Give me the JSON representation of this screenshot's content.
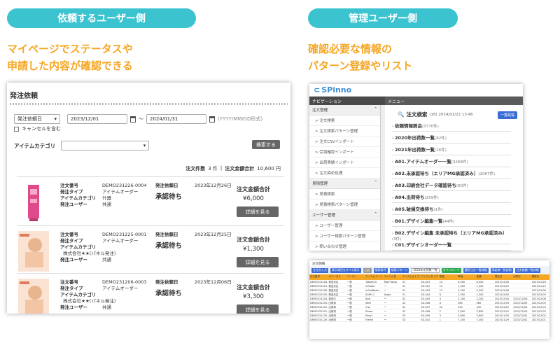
{
  "left_section": {
    "pill": "依頼するユーザー側",
    "headline": [
      "マイページでステータスや",
      "申請した内容が確認できる"
    ],
    "panel": {
      "title": "発注依頼",
      "filter": {
        "date_type": "発注依頼日",
        "date_from": "2023/12/01",
        "tilde": "〜",
        "date_to": "2024/01/31",
        "date_hint": "(YYYY/MM/DD形式)",
        "cancel_label": "キャンセルを含む",
        "category_label": "アイテムカテゴリ",
        "search_button": "検索する"
      },
      "summary": {
        "count_label": "注文件数",
        "count": "3 件",
        "sep": "|",
        "total_label": "注文金額合計",
        "total": "10,600 円"
      },
      "labels": {
        "order_no": "注文番号",
        "order_type": "発注タイプ",
        "item_category": "アイテムカテゴリ",
        "orderer": "発注ユーザー",
        "request_date": "発注依頼日",
        "total_label": "注文金額合計",
        "detail_button": "詳細を見る"
      },
      "orders": [
        {
          "order_no": "DEMO231226-0004",
          "order_type": "アイテムオーダー",
          "category": "什器",
          "company": "",
          "orderer": "共通",
          "date": "2023年12月26日",
          "status": "承認待ち",
          "price": "¥6,000"
        },
        {
          "order_no": "DEMO231225-0001",
          "order_type": "アイテムオーダー",
          "category": "",
          "company": "株式会社★★(パネル発注)",
          "orderer": "共通",
          "date": "2023年12月25日",
          "status": "承認待ち",
          "price": "¥1,300"
        },
        {
          "order_no": "DEMO231206-0003",
          "order_type": "アイテムオーダー",
          "category": "",
          "company": "株式会社★★(パネル発注)",
          "orderer": "共通",
          "date": "2023年12月06日",
          "status": "承認待ち",
          "price": "¥3,300"
        }
      ]
    }
  },
  "right_section": {
    "pill": "管理ユーザー側",
    "headline": [
      "確認必要な情報の",
      "パターン登録やリスト"
    ],
    "admin": {
      "logo": "SPinno",
      "nav_header": "ナビゲーション",
      "menu_header": "メニュー",
      "nav_groups": [
        {
          "title": "注文管理",
          "items": [
            "注文検索",
            "注文検索パターン管理",
            "注文CSVインポート",
            "受領確認インポート",
            "出荷実績インポート",
            "注文締め処理"
          ]
        },
        {
          "title": "見積管理",
          "items": [
            "見積検索",
            "見積検索パターン管理"
          ]
        },
        {
          "title": "ユーザー管理",
          "items": [
            "ユーザー管理",
            "ユーザー検索パターン管理",
            "問い合わせ管理"
          ]
        }
      ],
      "main_title": "注文検索",
      "main_sub": "(18) 2024/01/22 13:46",
      "main_button": "一覧取得",
      "patterns": [
        {
          "name": "依頼情報照会",
          "count": "(3770件)"
        },
        {
          "name": "2020年出荷数一覧",
          "count": "(82件)"
        },
        {
          "name": "2021年出荷数一覧",
          "count": "(26件)"
        },
        {
          "name": "A01.アイテムオーダー一覧",
          "count": "(3268件)"
        },
        {
          "name": "A02.未承認待ち（エリアMG承認済み）",
          "count": "(2067件)"
        },
        {
          "name": "A03.印刷会社データ確認待ち",
          "count": "(60件)"
        },
        {
          "name": "A04.出荷待ち",
          "count": "(259件)"
        },
        {
          "name": "A05.破損交換待ち",
          "count": "(1件)"
        },
        {
          "name": "B01.デザイン編集一覧",
          "count": "(44件)"
        },
        {
          "name": "B02.デザイン編集 未承認待ち（エリアMG承認済み）",
          "count": "(3件)"
        },
        {
          "name": "C01.デザインオーダー一覧",
          "count": ""
        }
      ]
    },
    "list": {
      "title": "注文明細",
      "toolbar": [
        "全注文入力",
        "表示項目をすべて表示",
        "CSV",
        "検索条件",
        "検索パターン",
        "2024年出荷数一覧",
        "ダウンロード",
        "選択注文一覧詳細",
        "承認済一覧詳細",
        "注文依頼一覧詳細"
      ],
      "headers": [
        "注文番号",
        "ステータス",
        "ユーザー",
        "アイテムコード",
        "アイテム名",
        "アイテムカテゴリ",
        "アイテムタイプ",
        "数量",
        "単価",
        "金額",
        "発注日",
        "出荷日",
        "更新日"
      ],
      "rows": [
        [
          "DEMO231226-0004",
          "発送未定",
          "一般",
          "TableSC0",
          "Roof Rests",
          "S1",
          "SG-001",
          "10",
          "6,000",
          "6,000",
          "2023/12/26",
          "",
          "2023/12/26"
        ],
        [
          "DEMO231225-0001",
          "発送未定",
          "一般",
          "Inflated",
          "ー",
          "S1",
          "SG-002",
          "15",
          "1,300",
          "1,300",
          "2023/12/25",
          "",
          "2023/12/25"
        ],
        [
          "DEMO231206-0003",
          "発送未定",
          "一般",
          "InfloxBooks",
          "ー",
          "S1",
          "SG-003",
          "12",
          "3,300",
          "3,300",
          "2023/12/06",
          "",
          "2023/12/06"
        ],
        [
          "DEMO231205-0002",
          "発送未定",
          "一般",
          "SAPH-1",
          "Angle",
          "S1",
          "SG-004",
          "8",
          "1,500",
          "1,500",
          "2023/12/05",
          "",
          "2023/12/05"
        ],
        [
          "DEMO231204-0001",
          "発送中",
          "一般",
          "Bolt",
          "ー",
          "S2",
          "SG-005",
          "4",
          "2,200",
          "2,200",
          "2023/12/04",
          "2023/12/06",
          "2023/12/06"
        ],
        [
          "DEMO231203-0005",
          "出荷済",
          "一般",
          "Wire",
          "ー",
          "S2",
          "SG-006",
          "6",
          "980",
          "980",
          "2023/12/03",
          "2023/12/05",
          "2023/12/05"
        ],
        [
          "DEMO231202-0004",
          "出荷済",
          "一般",
          "Clip",
          "ー",
          "S2",
          "SG-007",
          "20",
          "450",
          "450",
          "2023/12/02",
          "2023/12/04",
          "2023/12/04"
        ],
        [
          "DEMO231201-0003",
          "出荷済",
          "一般",
          "Sheet",
          "ー",
          "S3",
          "SG-008",
          "2",
          "3,800",
          "3,800",
          "2023/12/01",
          "2023/12/03",
          "2023/12/03"
        ],
        [
          "DEMO231130-0002",
          "出荷済",
          "一般",
          "Panel",
          "ー",
          "S3",
          "SG-009",
          "3",
          "5,600",
          "5,600",
          "2023/11/30",
          "2023/12/02",
          "2023/12/02"
        ],
        [
          "DEMO231129-0001",
          "出荷済",
          "一般",
          "Frame",
          "ー",
          "S3",
          "SG-010",
          "1",
          "7,200",
          "7,200",
          "2023/11/29",
          "2023/12/01",
          "2023/12/01"
        ]
      ]
    }
  },
  "colors": {
    "accent": "#3cc3d0",
    "headline": "#f5a623",
    "admin_blue": "#3b6cd6",
    "table_header": "#f5a623"
  }
}
